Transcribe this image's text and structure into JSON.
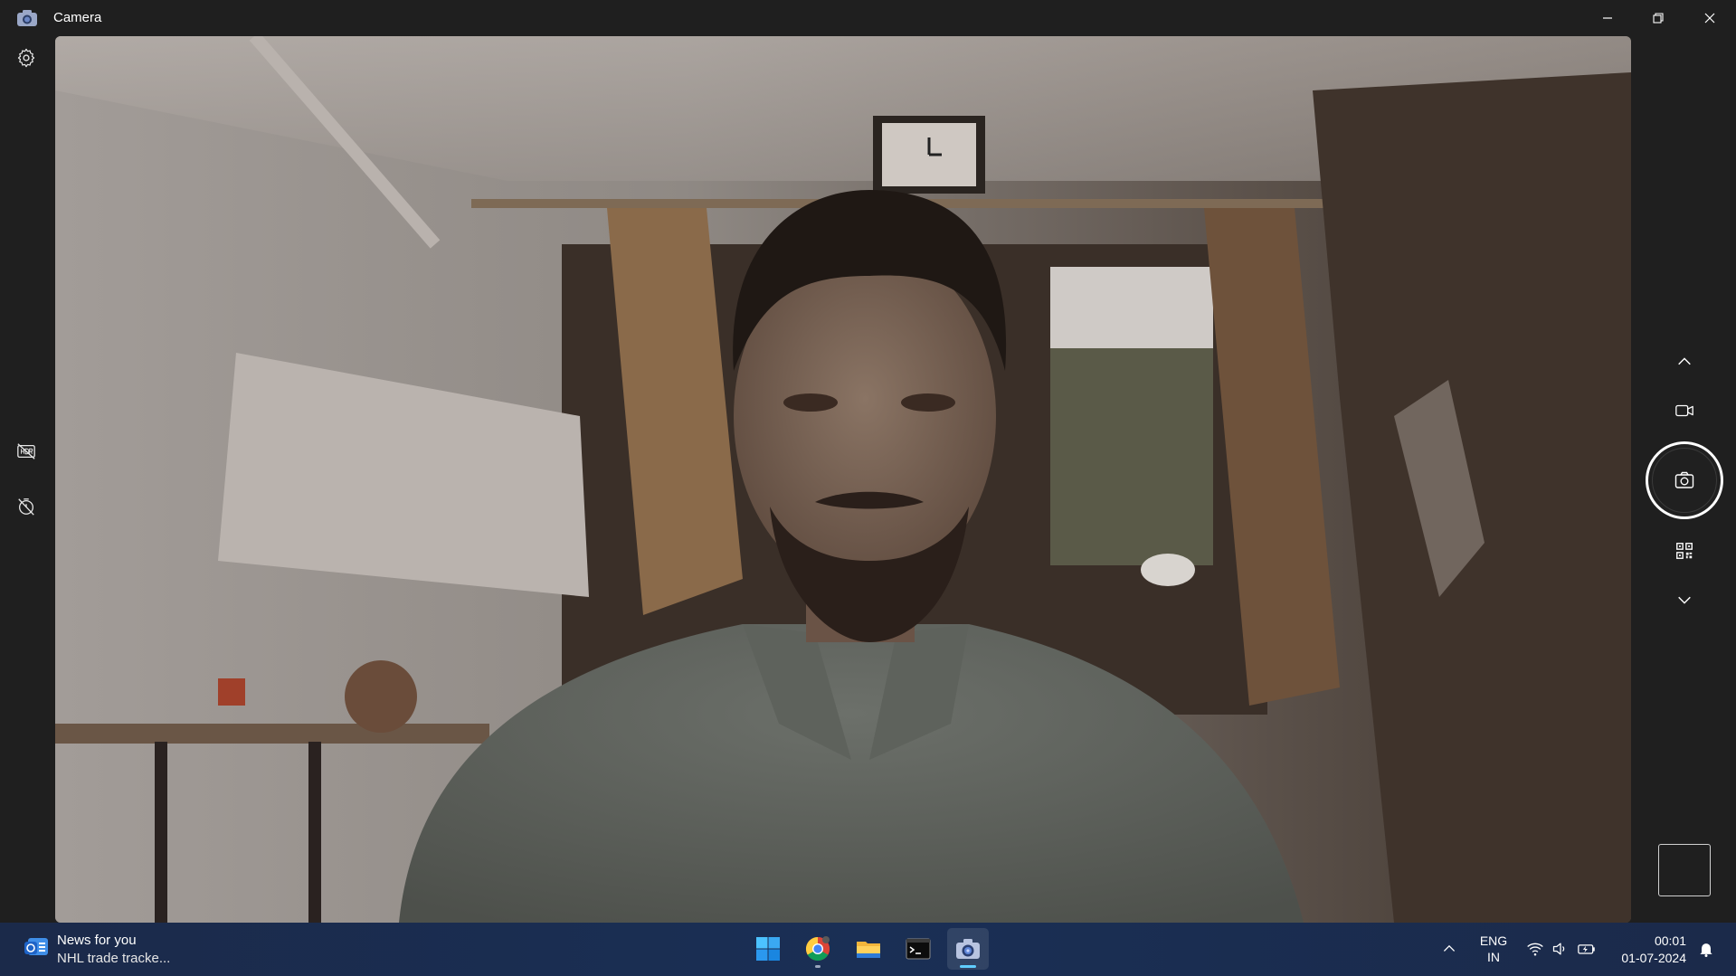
{
  "window": {
    "title": "Camera",
    "icons": [
      "camera-app-icon",
      "minimize-icon",
      "restore-icon",
      "close-icon"
    ]
  },
  "left_rail": {
    "icons": [
      "settings-icon",
      "hdr-off-icon",
      "timer-off-icon"
    ]
  },
  "viewfinder": {
    "description_hidden": true
  },
  "right_controls": {
    "icons": [
      "chevron-up-icon",
      "video-mode-icon",
      "photo-shutter-icon",
      "qr-scan-icon",
      "chevron-down-icon",
      "last-capture-thumbnail"
    ]
  },
  "taskbar": {
    "news": {
      "title": "News for you",
      "subtitle": "NHL trade tracke..."
    },
    "apps": [
      "start-icon",
      "chrome-icon",
      "file-explorer-icon",
      "terminal-icon",
      "camera-icon"
    ],
    "tray": {
      "lang_top": "ENG",
      "lang_bottom": "IN",
      "time": "00:01",
      "date": "01-07-2024"
    }
  },
  "colors": {
    "accent": "#60cdff",
    "taskbar": "#1a2f55",
    "titlebar": "#1f1f1f"
  }
}
